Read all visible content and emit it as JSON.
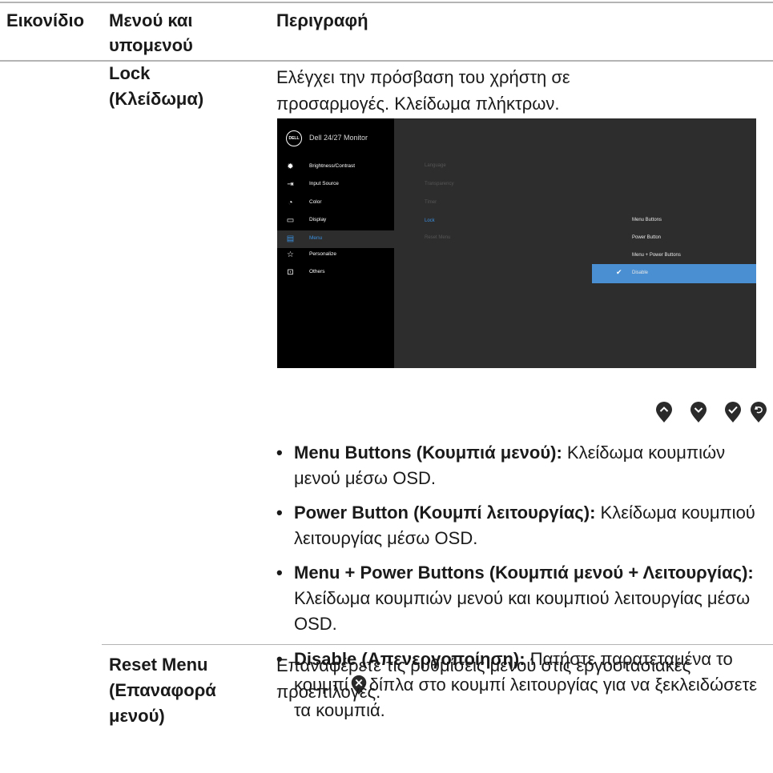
{
  "header": {
    "col_icon": "Εικονίδιο",
    "col_menu": "Μενού και υπομενού",
    "col_desc": "Περιγραφή"
  },
  "lock_row": {
    "name": "Lock (Κλείδωμα)",
    "intro": "Ελέγχει την πρόσβαση του χρήστη σε προσαρμογές. Κλείδωμα πλήκτρων.",
    "osd": {
      "logo": "DELL",
      "title": "Dell 24/27 Monitor",
      "menu": [
        {
          "label": "Brightness/Contrast",
          "icon": "sun-icon"
        },
        {
          "label": "Input Source",
          "icon": "input-icon"
        },
        {
          "label": "Color",
          "icon": "color-icon"
        },
        {
          "label": "Display",
          "icon": "display-icon"
        },
        {
          "label": "Menu",
          "icon": "menu-icon"
        },
        {
          "label": "Personalize",
          "icon": "star-icon"
        },
        {
          "label": "Others",
          "icon": "others-icon"
        }
      ],
      "submenu": [
        "Language",
        "Transparency",
        "Timer",
        "Lock",
        "Reset Menu"
      ],
      "options": [
        "Menu Buttons",
        "Power Button",
        "Menu + Power Buttons",
        "Disable"
      ],
      "selected_option": "Disable"
    },
    "nav_icons": [
      "up-icon",
      "down-icon",
      "check-icon",
      "back-icon"
    ],
    "bullets": [
      {
        "term": "Menu Buttons (Κουμπιά μενού):",
        "text": "Κλείδωμα κουμπιών μενού μέσω OSD."
      },
      {
        "term": "Power Button (Κουμπί λειτουργίας):",
        "text": "Κλείδωμα κουμπιού λειτουργίας μέσω OSD."
      },
      {
        "term": "Menu + Power Buttons (Κουμπιά μενού + Λειτουργίας):",
        "text": "Κλείδωμα κουμπιών μενού και κουμπιού λειτουργίας μέσω OSD."
      },
      {
        "term": "Disable (Απενεργοποίηση):",
        "text_before": "Πατήστε παρατεταμένα το κουμπί",
        "text_after": "δίπλα στο κουμπί λειτουργίας για να ξεκλειδώσετε τα κουμπιά."
      }
    ]
  },
  "reset_row": {
    "name": "Reset Menu (Επαναφορά μενού)",
    "desc": "Επαναφέρετε τις ρυθμίσεις μενού στις εργοστασιακές προεπιλογές."
  }
}
